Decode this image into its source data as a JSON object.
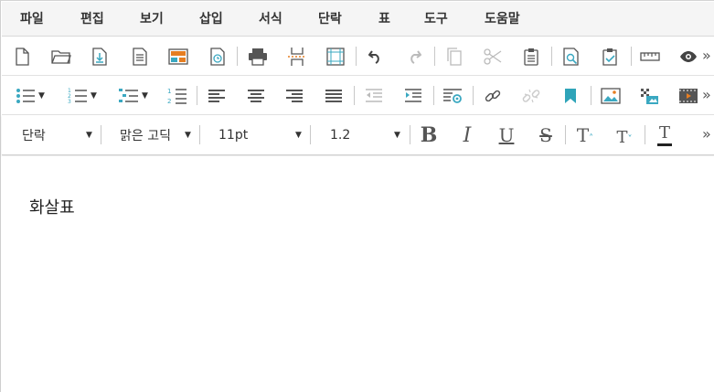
{
  "menu": {
    "items": [
      "파일",
      "편집",
      "보기",
      "삽입",
      "서식",
      "단락",
      "표",
      "도구",
      "도움말"
    ]
  },
  "toolbar1": {
    "icons": [
      "new-document-icon",
      "open-folder-icon",
      "download-icon",
      "document-icon",
      "template-icon",
      "history-icon",
      "print-icon",
      "page-break-icon",
      "page-layout-icon",
      "undo-icon",
      "redo-icon",
      "copy-icon",
      "cut-icon",
      "paste-icon",
      "find-icon",
      "replace-icon",
      "ruler-icon",
      "preview-icon"
    ],
    "more_label": "»"
  },
  "toolbar2": {
    "icons": [
      "bullet-list-icon",
      "numbered-list-icon",
      "multilevel-list-icon",
      "line-numbering-icon",
      "align-left-icon",
      "align-center-icon",
      "align-right-icon",
      "justify-icon",
      "outdent-icon",
      "indent-icon",
      "insert-field-icon",
      "link-icon",
      "unlink-icon",
      "bookmark-icon",
      "image-icon",
      "insert-object-icon",
      "video-icon"
    ],
    "more_label": "»"
  },
  "toolbar3": {
    "paragraph_style": "단락",
    "font_family": "맑은 고딕",
    "font_size": "11pt",
    "line_height": "1.2",
    "bold_label": "B",
    "italic_label": "I",
    "underline_label": "U",
    "strike_label": "S",
    "superscript_label": "T",
    "subscript_label": "T",
    "font_color_label": "T",
    "more_label": "»"
  },
  "document": {
    "text": "화살표"
  },
  "colors": {
    "accent": "#3aa8c1",
    "bookmark": "#2fa4b9",
    "menubar_bg": "#f5f5f5"
  }
}
